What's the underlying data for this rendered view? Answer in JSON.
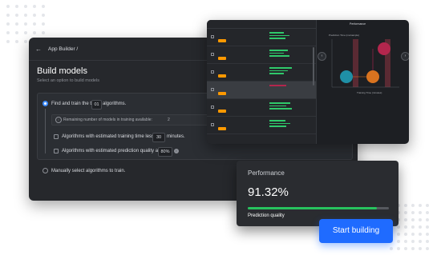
{
  "app_builder": {
    "breadcrumb": "App Builder /",
    "title": "Build models",
    "subtitle": "Select an option to build models",
    "option_find_prefix": "Find and train the top",
    "option_find_value": "01",
    "option_find_suffix": "algorithms.",
    "remaining_text": "Remaining number of models in training available:",
    "remaining_count": "2",
    "time_prefix": "Algorithms with estimated training time less than",
    "time_value": "30",
    "time_suffix": "minutes.",
    "quality_prefix": "Algorithms with estimated prediction quality at least",
    "quality_value": "80%",
    "option_manual": "Manually select algorithms to train."
  },
  "perf_panel": {
    "title": "Performance",
    "y_axis_label": "Prediction Time (ms/sample)",
    "x_axis_label": "Training Time (minutes)"
  },
  "card": {
    "label": "Performance",
    "value": "91.32%",
    "progress_fraction": 0.9132,
    "sublabel": "Prediction quality"
  },
  "cta": {
    "label": "Start building"
  },
  "colors": {
    "accent_blue": "#1f6bff",
    "progress_green": "#27c25e",
    "bubble_red": "#b3264d",
    "bubble_teal": "#1f8fa6",
    "bubble_orange": "#d9731f",
    "tag_orange": "#ff9900"
  }
}
